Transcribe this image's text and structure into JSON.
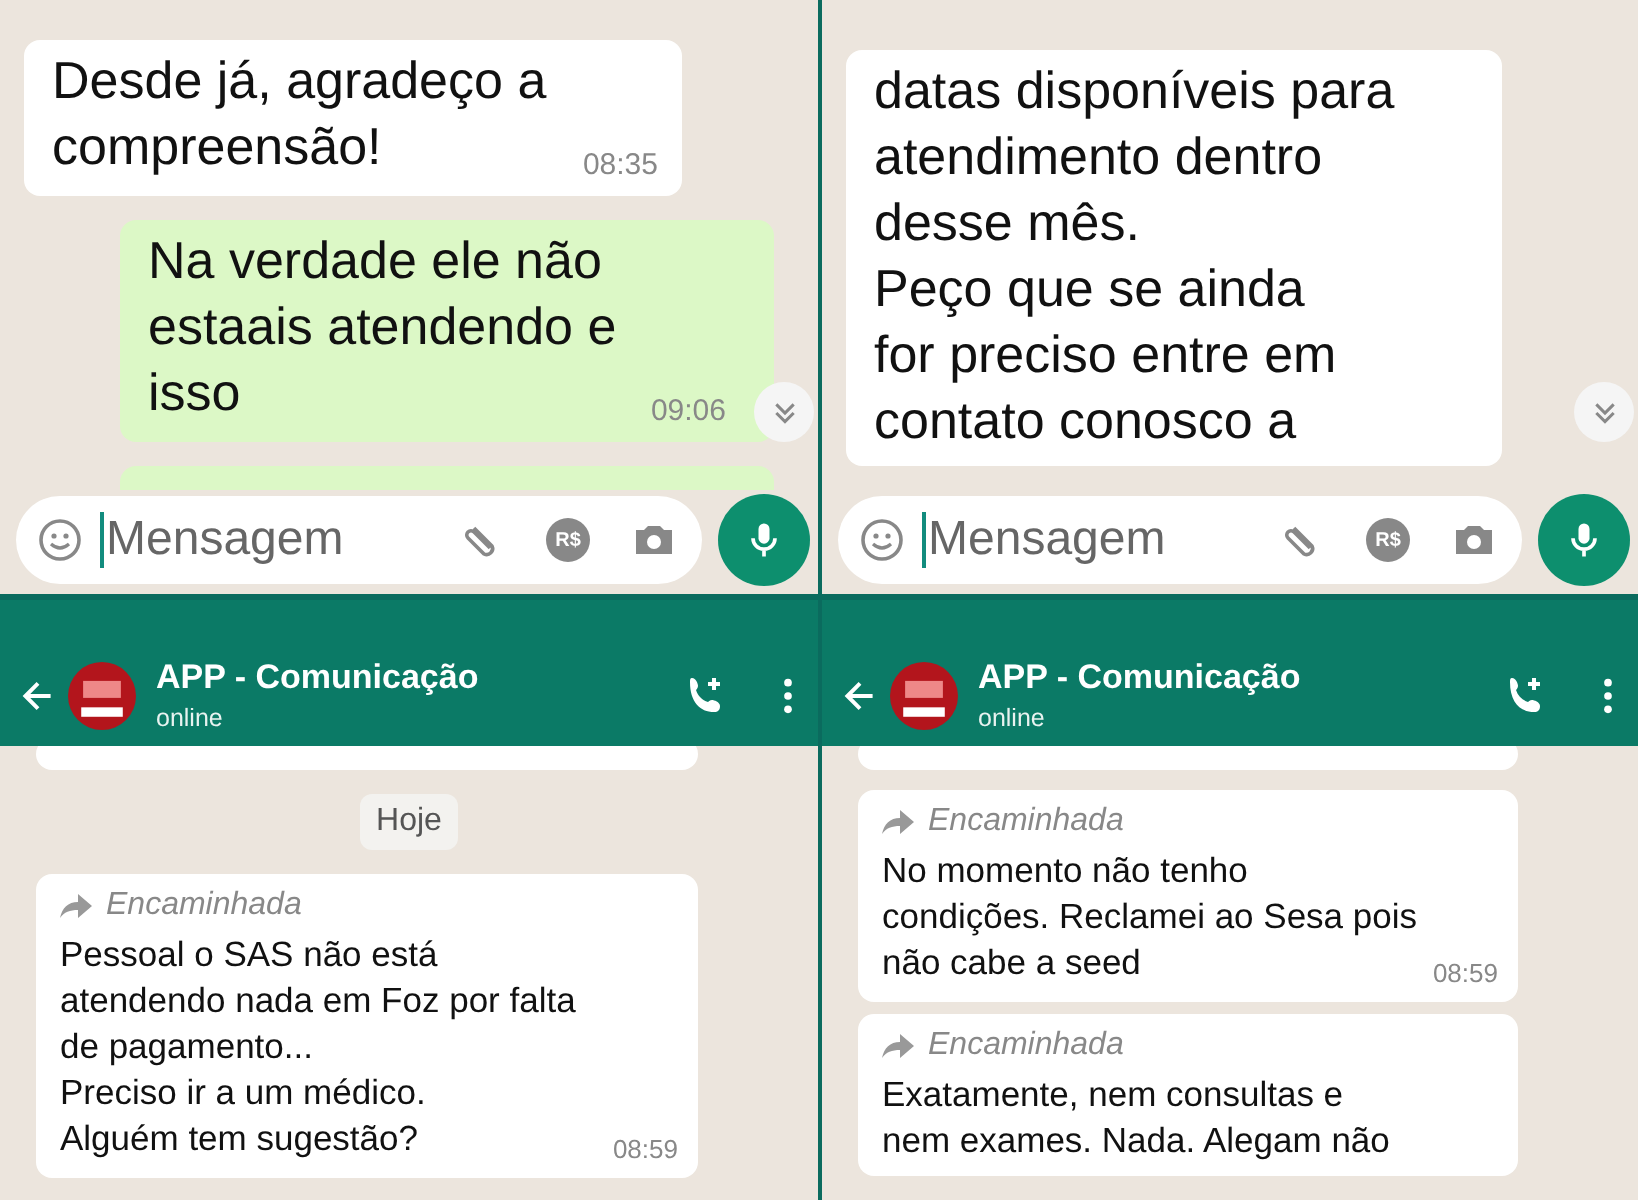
{
  "panels": [
    {
      "kind": "composer",
      "messages": [
        {
          "kind": "incoming",
          "lines": [
            "Desde já, agradeço a",
            "compreensão!"
          ],
          "time": "08:35"
        },
        {
          "kind": "outgoing",
          "lines": [
            "Na verdade ele não",
            "estaais atendendo e",
            "isso"
          ],
          "time": "09:06"
        },
        {
          "kind": "partial_outgoing"
        }
      ],
      "scroll_button": true,
      "composer": {
        "placeholder": "Mensagem",
        "currency": "R$"
      }
    },
    {
      "kind": "composer",
      "messages": [
        {
          "kind": "incoming",
          "lines": [
            "datas disponíveis para",
            "atendimento dentro",
            "desse mês.",
            "Peço que se ainda",
            "for preciso entre em",
            "contato conosco a"
          ]
        }
      ],
      "scroll_button": true,
      "composer": {
        "placeholder": "Mensagem",
        "currency": "R$"
      }
    },
    {
      "kind": "header",
      "header": {
        "title": "APP - Comunicação",
        "status": "online"
      },
      "messages": [
        {
          "kind": "partial_incoming"
        },
        {
          "kind": "date",
          "label": "Hoje"
        },
        {
          "kind": "incoming",
          "forwarded": "Encaminhada",
          "lines": [
            "Pessoal o SAS não está",
            "atendendo nada em Foz por falta",
            "de pagamento...",
            "Preciso ir a um médico.",
            "Alguém tem sugestão?"
          ],
          "time": "08:59"
        }
      ]
    },
    {
      "kind": "header",
      "header": {
        "title": "APP - Comunicação",
        "status": "online"
      },
      "messages": [
        {
          "kind": "partial_incoming"
        },
        {
          "kind": "incoming",
          "forwarded": "Encaminhada",
          "lines": [
            "No momento não tenho",
            "condições. Reclamei ao Sesa pois",
            "não cabe a seed"
          ],
          "time": "08:59"
        },
        {
          "kind": "incoming",
          "forwarded": "Encaminhada",
          "lines": [
            "Exatamente, nem consultas  e",
            "nem exames. Nada. Alegam não"
          ]
        }
      ]
    }
  ]
}
